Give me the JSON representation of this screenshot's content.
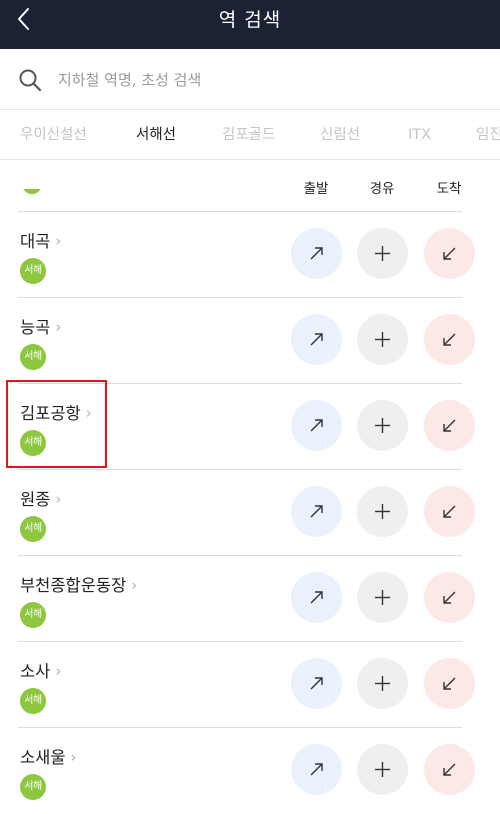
{
  "header": {
    "title": "역 검색",
    "back_icon": "back-arrow-icon"
  },
  "search": {
    "placeholder": "지하철 역명, 초성 검색",
    "value": "",
    "icon": "search-icon"
  },
  "tabs": [
    {
      "label": "우이신설선",
      "active": false
    },
    {
      "label": "서해선",
      "active": true
    },
    {
      "label": "김포골드",
      "active": false
    },
    {
      "label": "신림선",
      "active": false
    },
    {
      "label": "ITX",
      "active": false
    },
    {
      "label": "임진",
      "active": false
    }
  ],
  "columns": {
    "depart": "출발",
    "via": "경유",
    "arrive": "도착"
  },
  "line_color": "#8dc63f",
  "stations": [
    {
      "name": "대곡",
      "badge": "서해"
    },
    {
      "name": "능곡",
      "badge": "서해"
    },
    {
      "name": "김포공항",
      "badge": "서해",
      "highlighted": true
    },
    {
      "name": "원종",
      "badge": "서해"
    },
    {
      "name": "부천종합운동장",
      "badge": "서해"
    },
    {
      "name": "소사",
      "badge": "서해"
    },
    {
      "name": "소새울",
      "badge": "서해"
    }
  ]
}
